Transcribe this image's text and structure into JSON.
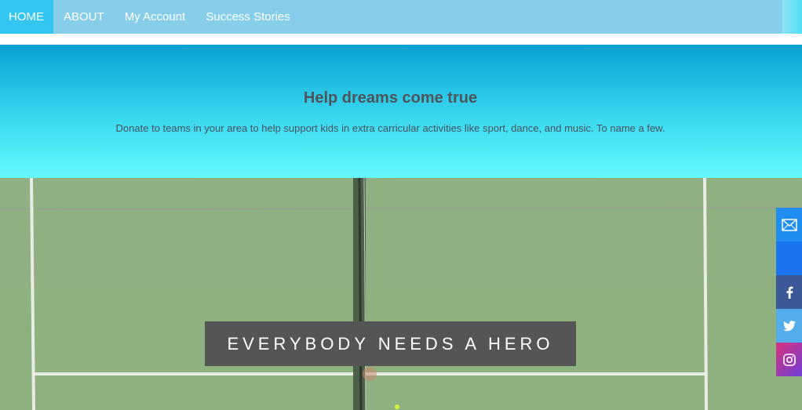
{
  "nav": {
    "items": [
      {
        "label": "HOME",
        "active": true
      },
      {
        "label": "ABOUT",
        "active": false
      },
      {
        "label": "My Account",
        "active": false
      },
      {
        "label": "Success Stories",
        "active": false
      }
    ]
  },
  "hero": {
    "title": "Help dreams come true",
    "subtitle": "Donate to teams in your area to help support kids in extra carricular activities like sport, dance, and music. To name a few."
  },
  "banner": {
    "cta": "EVERYBODY NEEDS A HERO"
  },
  "social": {
    "buttons": [
      {
        "icon": "mail-icon",
        "color": "#1f8df2"
      },
      {
        "icon": "blank",
        "color": "#1a74f0"
      },
      {
        "icon": "facebook-icon",
        "color": "#3b5998"
      },
      {
        "icon": "twitter-icon",
        "color": "#55aceb"
      },
      {
        "icon": "instagram-icon",
        "color": "#c9357f"
      }
    ]
  },
  "colors": {
    "nav_bg": "#87ceea",
    "nav_active": "#33c6f2",
    "court_green": "#8fb07f",
    "cta_bg": "#555555"
  }
}
